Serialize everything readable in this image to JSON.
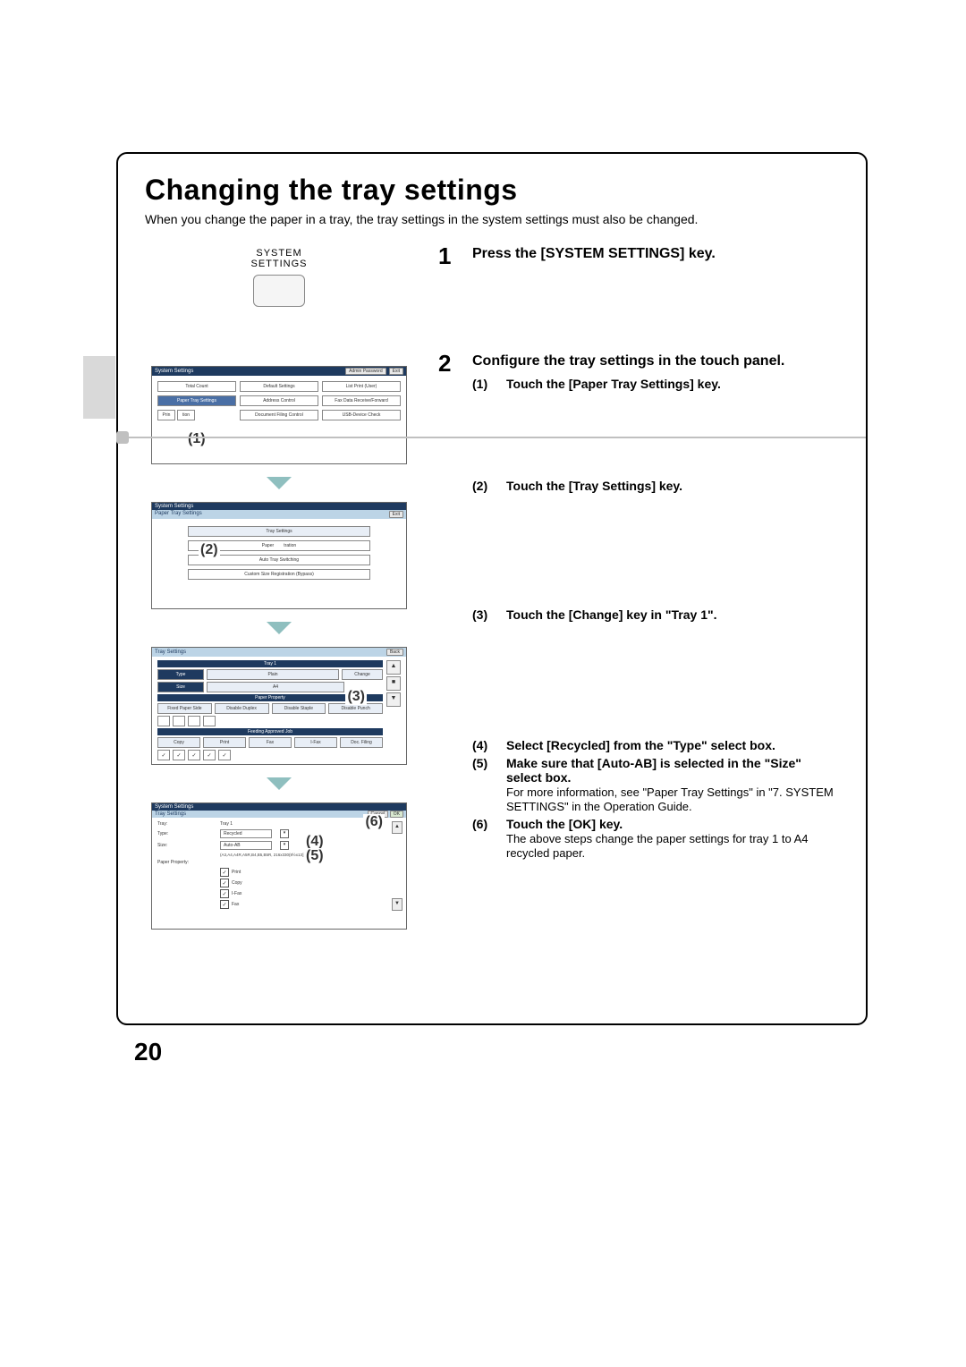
{
  "page_number": "20",
  "title": "Changing the tray settings",
  "intro": "When you change the paper in a tray, the tray settings in the system settings must also be changed.",
  "sys_key": {
    "line1": "SYSTEM",
    "line2": "SETTINGS"
  },
  "steps": {
    "s1": {
      "num": "1",
      "title": "Press the [SYSTEM SETTINGS] key."
    },
    "s2": {
      "num": "2",
      "title": "Configure the tray settings in the touch panel.",
      "subs": {
        "a": {
          "paren": "(1)",
          "text": "Touch the [Paper Tray Settings] key."
        },
        "b": {
          "paren": "(2)",
          "text": "Touch the [Tray Settings] key."
        },
        "c": {
          "paren": "(3)",
          "text": "Touch the [Change] key in \"Tray 1\"."
        },
        "d": {
          "paren": "(4)",
          "text": "Select [Recycled] from the \"Type\" select box."
        },
        "e": {
          "paren": "(5)",
          "text_bold": "Make sure that [Auto-AB] is selected in the \"Size\" select box.",
          "text_plain1": "For more information, see \"Paper Tray Settings\" in \"7. SYSTEM SETTINGS\" in the Operation Guide."
        },
        "f": {
          "paren": "(6)",
          "text_bold": "Touch the [OK] key.",
          "text_plain1": "The above steps change the paper settings for tray 1 to A4 recycled paper."
        }
      }
    }
  },
  "callouts": {
    "c1": "(1)",
    "c2": "(2)",
    "c3": "(3)",
    "c4": "(4)",
    "c5": "(5)",
    "c6": "(6)"
  },
  "panel1": {
    "title": "System Settings",
    "admin": "Admin Password",
    "exit": "Exit",
    "cells": {
      "total_count": "Total Count",
      "default": "Default Settings",
      "list_print": "List Print (User)",
      "paper_tray": "Paper Tray Settings",
      "address": "Address Control",
      "fax_data": "Fax Data Receive/Forward",
      "printer_cond": "Printer Condition",
      "doc_filing": "Document Filing Control",
      "usb": "USB-Device Check"
    },
    "printer_left": "Prin",
    "printer_right": "tion"
  },
  "panel2": {
    "title": "System Settings",
    "subtitle": "Paper Tray Settings",
    "exit": "Exit",
    "items": {
      "tray_settings_head": "Tray Settings",
      "paper_reg_left": "Paper",
      "paper_reg_right": "tration",
      "auto_tray": "Auto Tray Switching",
      "custom_size": "Custom Size Registration (Bypass)"
    }
  },
  "panel3": {
    "title": "Tray Settings",
    "back": "Back",
    "tray1": "Tray 1",
    "type": "Type",
    "plain": "Plain",
    "change": "Change",
    "size": "Size",
    "a4": "A4",
    "prop_header": "Paper Property",
    "fixed_side": "Fixed Paper Side",
    "disable_dup": "Disable Duplex",
    "disable_stap": "Disable Staple",
    "disable_punch": "Disable Punch",
    "approved_header": "Feeding Approved Job",
    "jobs": {
      "copy": "Copy",
      "print": "Print",
      "fax": "Fax",
      "ifax": "I-Fax",
      "filing": "Doc. Filing"
    },
    "scroll_up": "▲",
    "scroll_mid": "■",
    "scroll_dn": "▼"
  },
  "panel4": {
    "title": "System Settings",
    "subtitle": "Tray Settings",
    "cancel": "Cancel",
    "ok": "OK",
    "rows": {
      "tray_label": "Tray:",
      "tray_val": "Tray 1",
      "type_label": "Type:",
      "type_val": "Recycled",
      "size_label": "Size:",
      "size_val": "Auto-AB",
      "size_note": "(A3,A4,A4R,A5R,B4,B5,B5R, 216x330(8½x13))",
      "prop_label": "Paper Property:"
    },
    "checks": {
      "print": "Print",
      "copy": "Copy",
      "ifax": "I-Fax",
      "fax": "Fax"
    },
    "scroll_up": "▲",
    "scroll_dn": "▼"
  }
}
